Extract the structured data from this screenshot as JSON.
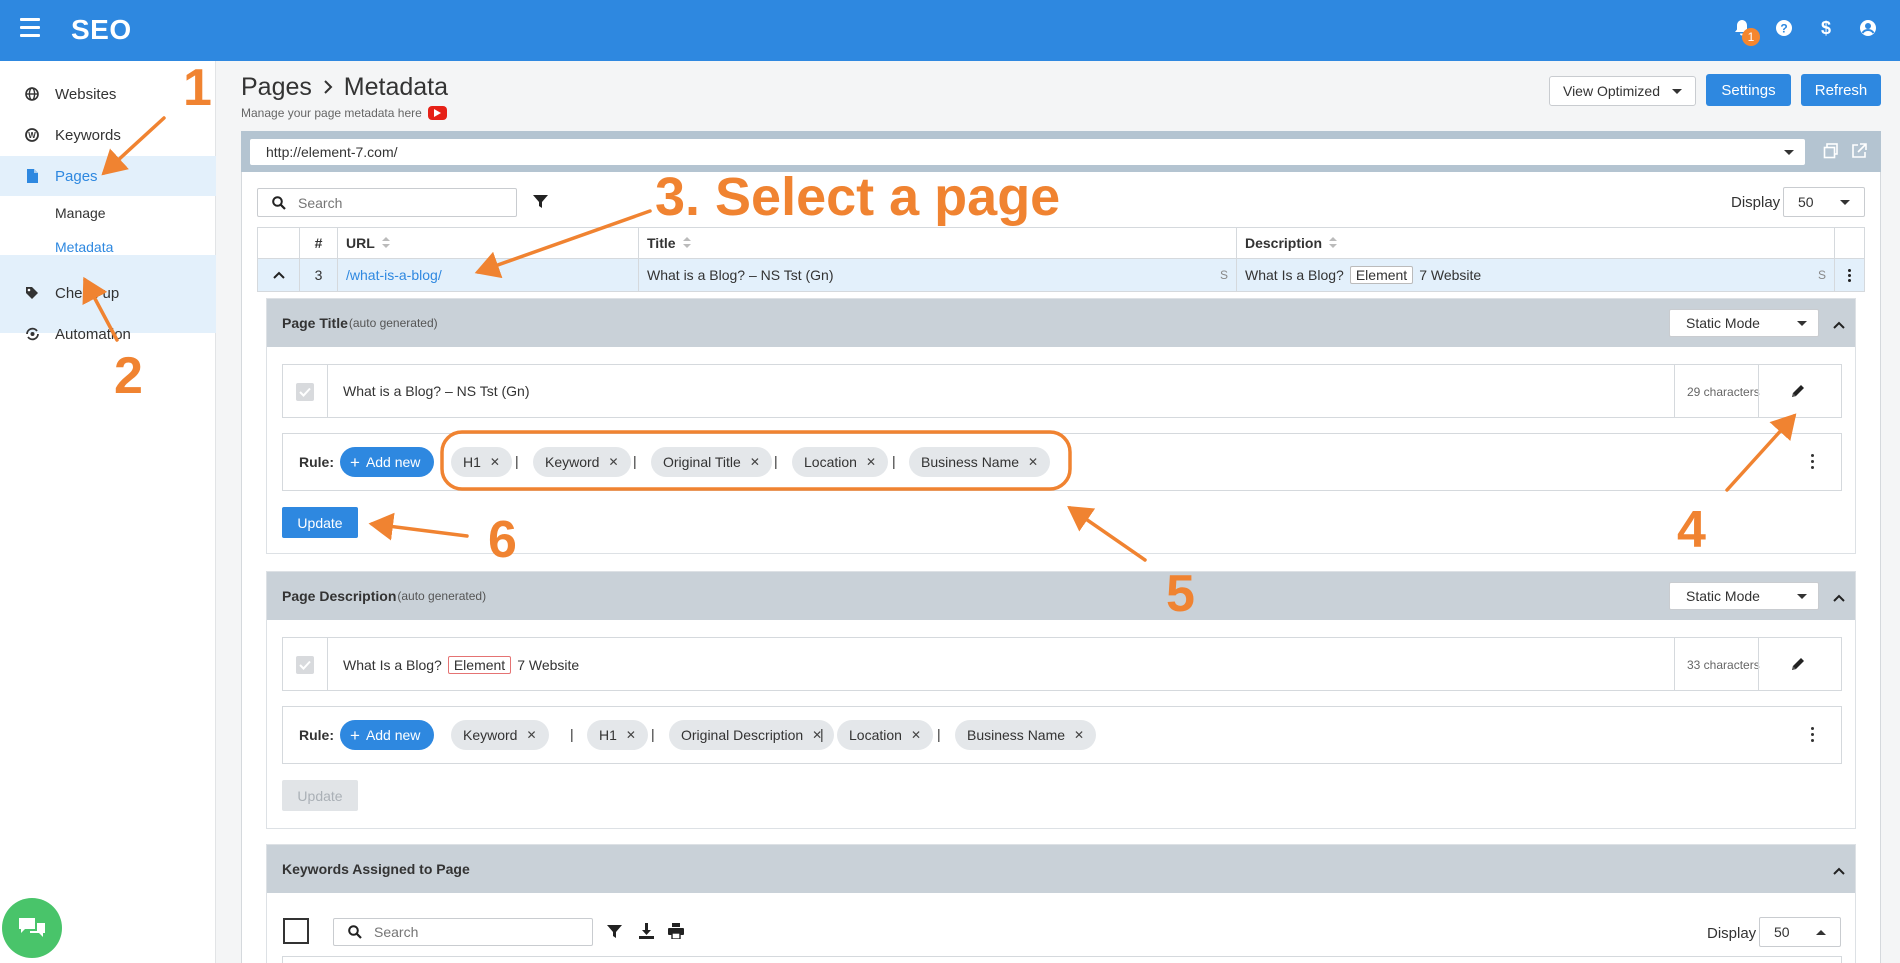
{
  "app": {
    "brand": "SEO",
    "notifications_count": "1"
  },
  "sidebar": {
    "items": [
      {
        "label": "Websites",
        "icon": "globe-icon"
      },
      {
        "label": "Keywords",
        "icon": "keyword-icon"
      },
      {
        "label": "Pages",
        "icon": "page-icon"
      },
      {
        "label": "Check-up",
        "icon": "tag-icon"
      },
      {
        "label": "Automation",
        "icon": "automation-icon"
      }
    ],
    "sub_items": [
      {
        "label": "Manage"
      },
      {
        "label": "Metadata"
      }
    ]
  },
  "header": {
    "breadcrumb_root": "Pages",
    "breadcrumb_current": "Metadata",
    "subtitle": "Manage your page metadata here",
    "view_select": "View Optimized",
    "settings_label": "Settings",
    "refresh_label": "Refresh"
  },
  "url_bar": {
    "value": "http://element-7.com/"
  },
  "pages_table": {
    "search_placeholder": "Search",
    "display_label": "Display",
    "display_value": "50",
    "columns": {
      "num": "#",
      "url": "URL",
      "title": "Title",
      "description": "Description"
    },
    "selected_row": {
      "num": "3",
      "url": "/what-is-a-blog/",
      "title": "What is a Blog? – NS Tst (Gn)",
      "title_mark": "S",
      "description_pre": "What Is a Blog?",
      "description_keyword": "Element",
      "description_post": "7 Website",
      "description_mark": "S"
    }
  },
  "title_section": {
    "heading": "Page Title",
    "auto_note": "(auto generated)",
    "mode": "Static Mode",
    "value": "What is a Blog? – NS Tst (Gn)",
    "char_count": "29 characters",
    "rule_label": "Rule:",
    "add_new_label": "Add new",
    "chips": [
      "H1",
      "Keyword",
      "Original Title",
      "Location",
      "Business Name"
    ],
    "separator": "|",
    "update_label": "Update"
  },
  "description_section": {
    "heading": "Page Description",
    "auto_note": "(auto generated)",
    "mode": "Static Mode",
    "value_pre": "What Is a Blog?",
    "value_keyword": "Element",
    "value_post": "7 Website",
    "char_count": "33 characters",
    "rule_label": "Rule:",
    "add_new_label": "Add new",
    "chips": [
      "Keyword",
      "H1",
      "Original Description",
      "Location",
      "Business Name"
    ],
    "separator": "|",
    "update_label": "Update"
  },
  "keywords_section": {
    "heading": "Keywords Assigned to Page",
    "search_placeholder": "Search",
    "display_label": "Display",
    "display_value": "50"
  },
  "annotations": {
    "n1": "1",
    "n2": "2",
    "n3": "3. Select a page",
    "n4": "4",
    "n5": "5",
    "n6": "6",
    "color": "#f08331"
  },
  "colors": {
    "primary": "#2e88e0",
    "annotation": "#f08331",
    "section_header": "#c9d1d8",
    "url_bar": "#b4c4d1"
  }
}
